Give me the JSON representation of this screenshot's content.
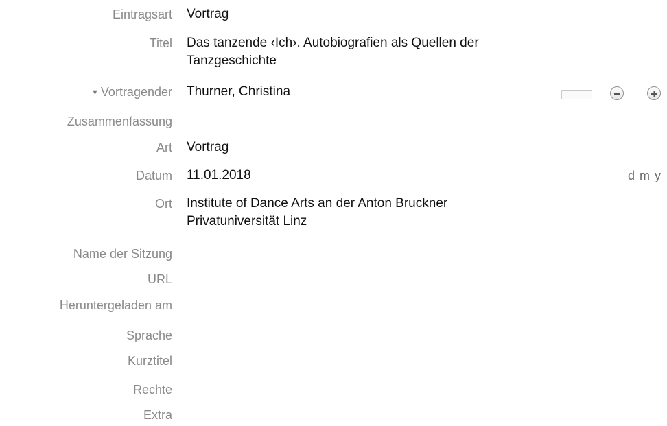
{
  "fields": {
    "eintragsart": {
      "label": "Eintragsart",
      "value": "Vortrag"
    },
    "titel": {
      "label": "Titel",
      "value_line1": "Das tanzende ‹Ich›. Autobiografien als Quellen der",
      "value_line2": "Tanzgeschichte"
    },
    "vortragender": {
      "label": "Vortragender",
      "value": "Thurner, Christina"
    },
    "zusammenfassung": {
      "label": "Zusammenfassung",
      "value": ""
    },
    "art": {
      "label": "Art",
      "value": "Vortrag"
    },
    "datum": {
      "label": "Datum",
      "value": "11.01.2018",
      "format": "d m y"
    },
    "ort": {
      "label": "Ort",
      "value_line1": "Institute of Dance Arts an der Anton Bruckner",
      "value_line2": "Privatuniversität Linz"
    },
    "name_der_sitzung": {
      "label": "Name der Sitzung",
      "value": ""
    },
    "url": {
      "label": "URL",
      "value": ""
    },
    "heruntergeladen_am": {
      "label": "Heruntergeladen am",
      "value": ""
    },
    "sprache": {
      "label": "Sprache",
      "value": ""
    },
    "kurztitel": {
      "label": "Kurztitel",
      "value": ""
    },
    "rechte": {
      "label": "Rechte",
      "value": ""
    },
    "extra": {
      "label": "Extra",
      "value": ""
    }
  },
  "icons": {
    "disclosure": "triangle-down-icon",
    "remove": "minus-circle-icon",
    "add": "plus-circle-icon"
  },
  "colors": {
    "label": "#8a8a8a",
    "value": "#111111"
  }
}
